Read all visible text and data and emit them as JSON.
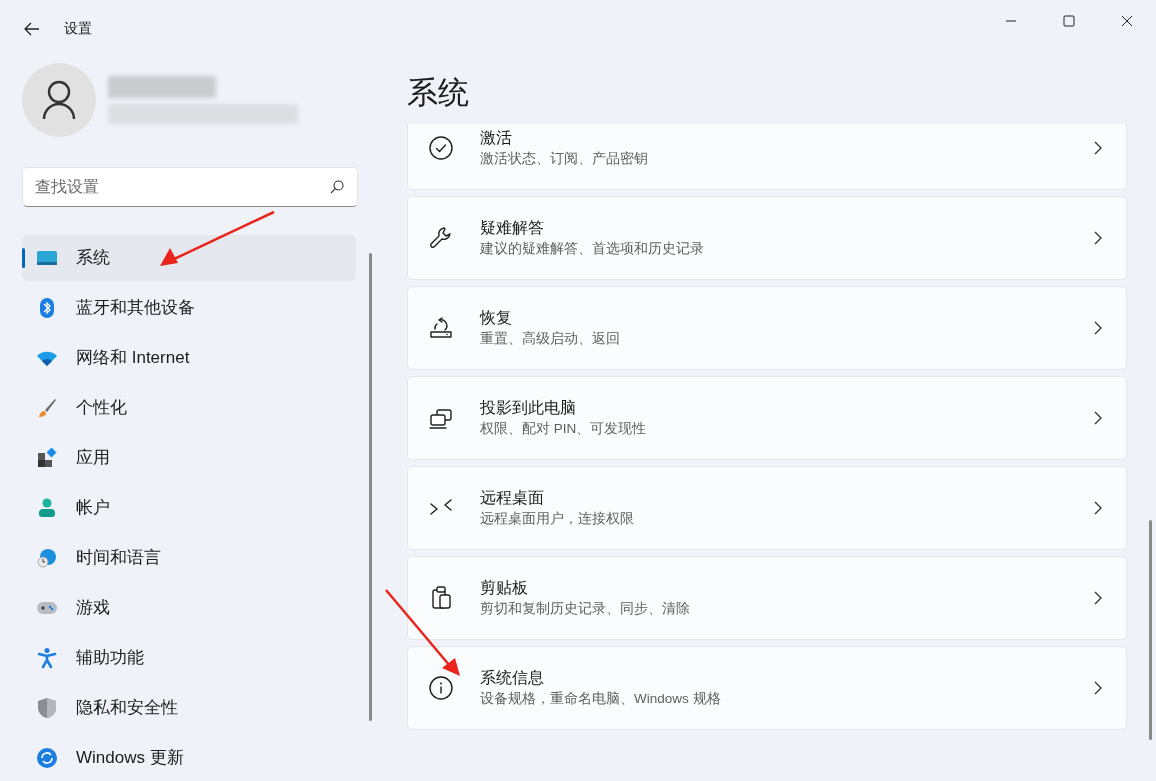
{
  "window": {
    "title": "设置",
    "controls": [
      {
        "kind": "minimize"
      },
      {
        "kind": "maximize"
      },
      {
        "kind": "close"
      }
    ]
  },
  "search": {
    "placeholder": "查找设置"
  },
  "sidebar": {
    "items": [
      {
        "label": "系统",
        "selected": true
      },
      {
        "label": "蓝牙和其他设备",
        "selected": false
      },
      {
        "label": "网络和 Internet",
        "selected": false
      },
      {
        "label": "个性化",
        "selected": false
      },
      {
        "label": "应用",
        "selected": false
      },
      {
        "label": "帐户",
        "selected": false
      },
      {
        "label": "时间和语言",
        "selected": false
      },
      {
        "label": "游戏",
        "selected": false
      },
      {
        "label": "辅助功能",
        "selected": false
      },
      {
        "label": "隐私和安全性",
        "selected": false
      },
      {
        "label": "Windows 更新",
        "selected": false
      }
    ]
  },
  "page": {
    "title": "系统",
    "cards": [
      {
        "title": "激活",
        "subtitle": "激活状态、订阅、产品密钥"
      },
      {
        "title": "疑难解答",
        "subtitle": "建议的疑难解答、首选项和历史记录"
      },
      {
        "title": "恢复",
        "subtitle": "重置、高级启动、返回"
      },
      {
        "title": "投影到此电脑",
        "subtitle": "权限、配对 PIN、可发现性"
      },
      {
        "title": "远程桌面",
        "subtitle": "远程桌面用户，连接权限"
      },
      {
        "title": "剪贴板",
        "subtitle": "剪切和复制历史记录、同步、清除"
      },
      {
        "title": "系统信息",
        "subtitle": "设备规格，重命名电脑、Windows 规格"
      }
    ]
  }
}
